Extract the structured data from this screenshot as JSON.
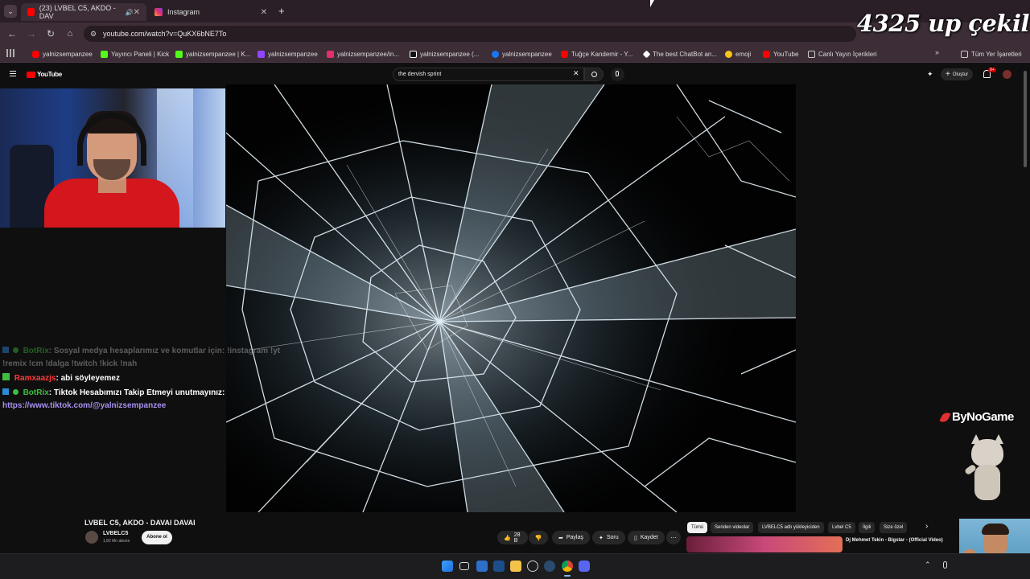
{
  "browser": {
    "tabs": [
      {
        "label": "(23) LVBEL C5, AKDO - DAV",
        "active": true
      },
      {
        "label": "Instagram",
        "active": false
      }
    ],
    "new_tab": "+",
    "url": "youtube.com/watch?v=QuKX6bNE7To",
    "bookmarks": [
      {
        "label": "yalnizsempanzee",
        "icon": "youtube-icon",
        "color": "#ff0000"
      },
      {
        "label": "Yayıncı Paneli | Kick",
        "icon": "kick-icon",
        "color": "#53fc18"
      },
      {
        "label": "yalnizsempanzee | K...",
        "icon": "kick-icon",
        "color": "#53fc18"
      },
      {
        "label": "yalnizsempanzee",
        "icon": "twitch-icon",
        "color": "#9146ff"
      },
      {
        "label": "yalnizsempanzee/in...",
        "icon": "instagram-icon",
        "color": "#e1306c"
      },
      {
        "label": "yalnizsempanzee (...",
        "icon": "tiktok-icon",
        "color": "#ffffff"
      },
      {
        "label": "yalnizsempanzee",
        "icon": "facebook-icon",
        "color": "#1877f2"
      },
      {
        "label": "Tuğçe Kandemir - Y...",
        "icon": "youtube-icon",
        "color": "#ff0000"
      },
      {
        "label": "The best ChatBot an...",
        "icon": "chatbot-icon",
        "color": "#ffffff"
      },
      {
        "label": "emoji",
        "icon": "emoji-icon",
        "color": "#f5c518"
      },
      {
        "label": "YouTube",
        "icon": "youtube-icon",
        "color": "#ff0000"
      },
      {
        "label": "Canlı Yayın İçerikleri",
        "icon": "folder-icon",
        "color": "#cccccc"
      }
    ],
    "all_bookmarks": "Tüm Yer İşaretleri"
  },
  "overlay": {
    "giveaway": "4325 up çekiliş",
    "brand": "ByNoGame"
  },
  "youtube": {
    "logo": "YouTube",
    "search_value": "the dervish sprint",
    "create_label": "Oluştur",
    "notif_count": "9+",
    "video_title": "LVBEL C5, AKDO - DAVAI DAVAI",
    "channel_name": "LVBELC5",
    "subscribers": "1,82 Mn abone",
    "subscribe_label": "Abone ol",
    "likes": "28 B",
    "share_label": "Paylaş",
    "ask_label": "Soru",
    "save_label": "Kaydet",
    "chips": [
      "Tümü",
      "Seriden videolar",
      "LVBELC5 adlı yükleyiciden",
      "Lvbel C5",
      "İlgili",
      "Size özel"
    ],
    "rec_title": "Dj Mehmet Tekin - Bigstar - (Official Video)"
  },
  "chat": [
    {
      "user": "BotRix",
      "text": ": Sosyal medya hesaplarımız ve komutlar için: !instagram !yt",
      "user_color": "#3fbf3f",
      "faded": true
    },
    {
      "user": "",
      "text": "!remix !cm !dalga !twitch !kick !nah",
      "user_color": "#ffffff",
      "faded": true
    },
    {
      "user": "Ramxaazjs",
      "text": ": abi söyleyemez",
      "user_color": "#ff3b3b",
      "faded": false
    },
    {
      "user": "BotRix",
      "text": ": Tiktok Hesabımızı Takip Etmeyi unutmayınız:",
      "user_color": "#3fbf3f",
      "faded": false
    },
    {
      "user": "",
      "text": "https://www.tiktok.com/@yalnizsempanzee",
      "user_color": "#a98ff0",
      "faded": false
    }
  ]
}
